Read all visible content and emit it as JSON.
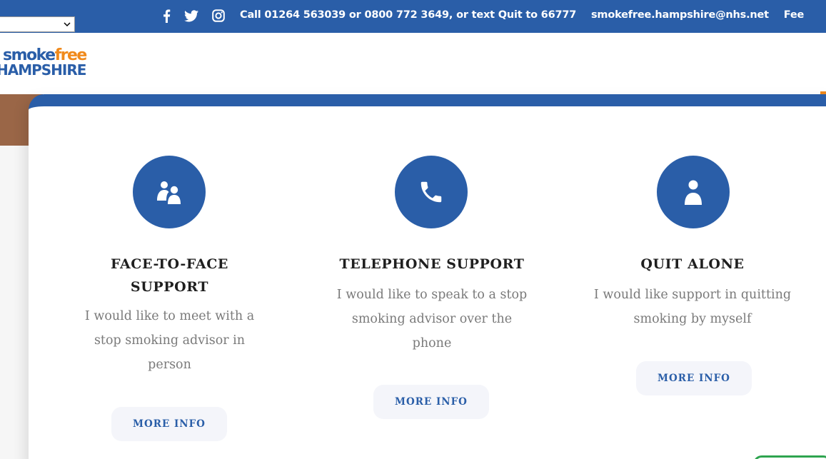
{
  "topbar": {
    "language_select_value": "",
    "social": [
      {
        "icon": "facebook-icon",
        "label": "Facebook"
      },
      {
        "icon": "twitter-icon",
        "label": "Twitter"
      },
      {
        "icon": "instagram-icon",
        "label": "Instagram"
      }
    ],
    "phone_text": "Call 01264 563039 or 0800 772 3649, or text Quit to 66777",
    "email": "smokefree.hampshire@nhs.net",
    "feedback_partial": "Fee"
  },
  "logo": {
    "part1": "smoke",
    "part2": "free",
    "line2": "HAMPSHIRE"
  },
  "colors": {
    "brand_blue": "#2a5ea8",
    "brand_orange": "#f08a1c",
    "title_text": "#1f1f1f",
    "body_text": "#7a7a7a",
    "button_bg": "#f4f5fa"
  },
  "options": [
    {
      "icon": "people-icon",
      "title": "FACE-TO-FACE SUPPORT",
      "description": "I would like to meet with a stop smoking advisor in person",
      "button": "MORE INFO"
    },
    {
      "icon": "phone-icon",
      "title": "TELEPHONE SUPPORT",
      "description": "I would like to speak to a stop smoking advisor over the phone",
      "button": "MORE INFO"
    },
    {
      "icon": "person-icon",
      "title": "QUIT ALONE",
      "description": "I would like support in quitting smoking by myself",
      "button": "MORE INFO"
    }
  ]
}
